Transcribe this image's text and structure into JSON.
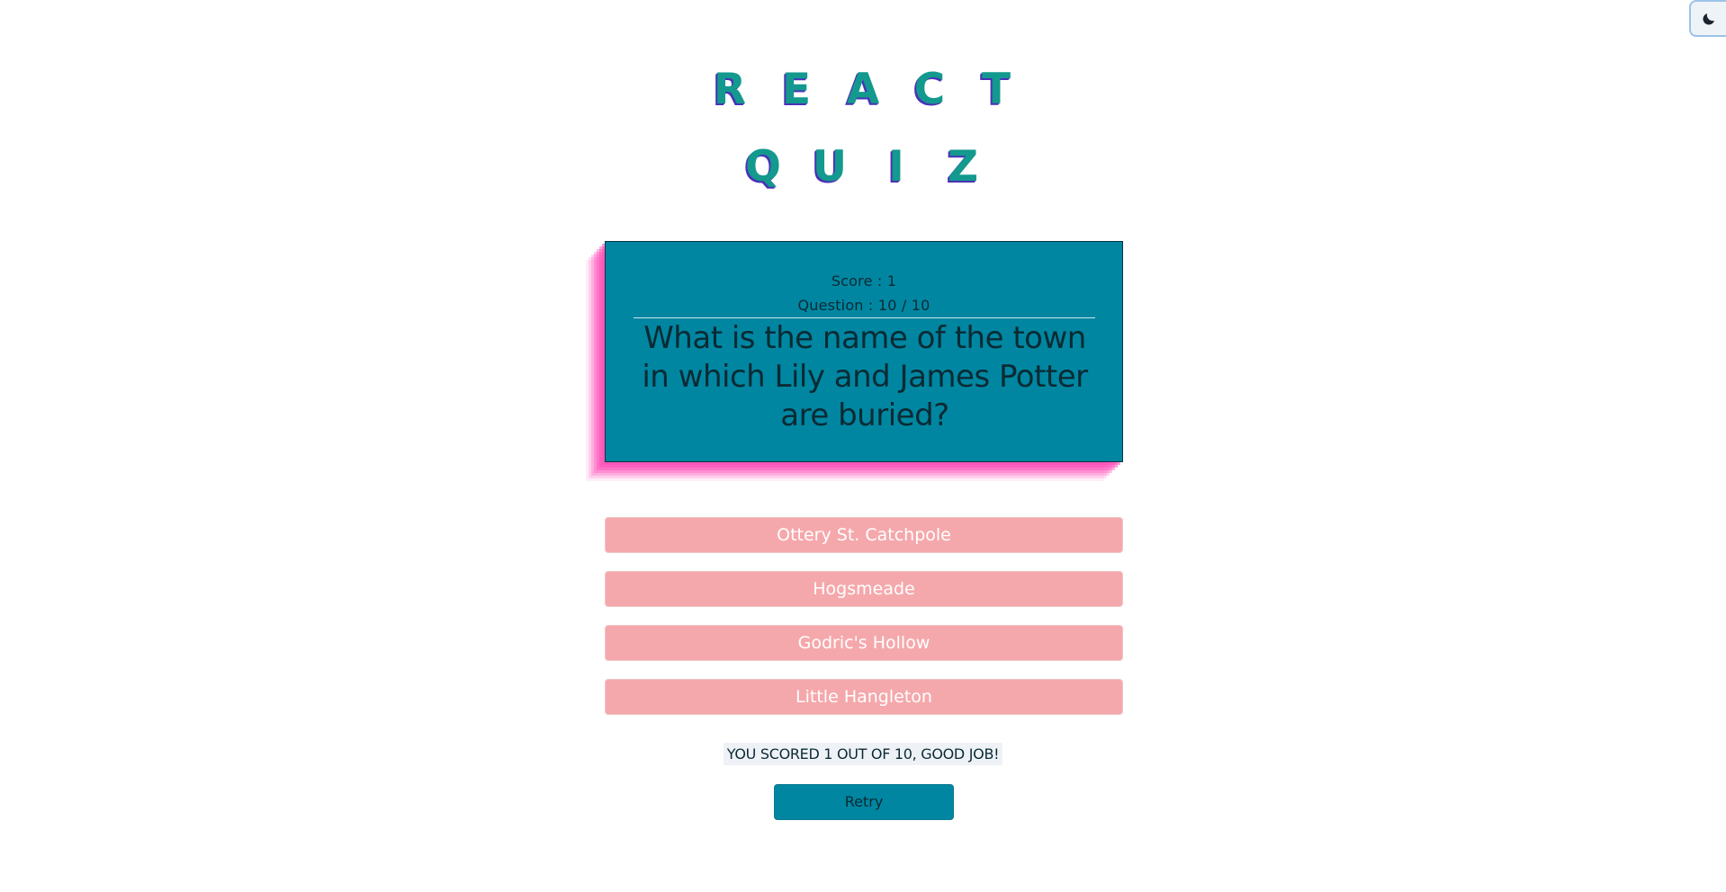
{
  "header": {
    "title_line_1": [
      "R",
      "E",
      "A",
      "C",
      "T"
    ],
    "title_line_2": [
      "Q",
      "U",
      "I",
      "Z"
    ]
  },
  "theme_toggle": {
    "icon": "moon-icon"
  },
  "card": {
    "score_text": "Score : 1",
    "question_count_text": "Question : 10 / 10",
    "question": "What is the name of the town in which Lily and James Potter are buried?"
  },
  "answers": [
    "Ottery St. Catchpole",
    "Hogsmeade",
    "Godric's Hollow",
    "Little Hangleton"
  ],
  "result": {
    "message": "YOU SCORED 1 OUT OF 10, GOOD JOB!",
    "retry_label": "Retry"
  },
  "colors": {
    "card_bg": "#0086a1",
    "card_shadow": "#ff4fb8",
    "answer_bg": "#f5a8ab",
    "title_fill": "#13998e",
    "title_shadow": "#4a31b8"
  }
}
